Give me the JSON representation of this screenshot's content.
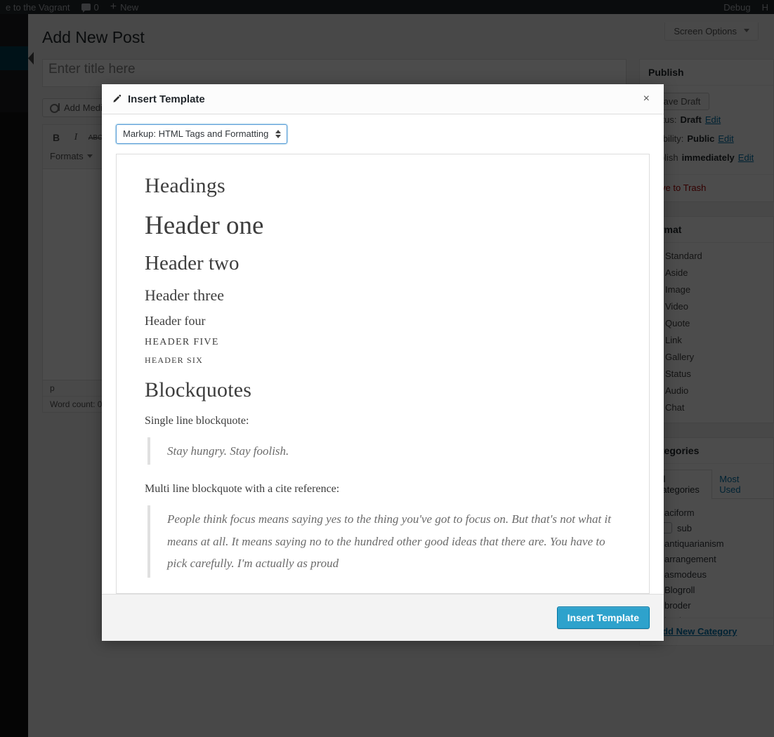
{
  "adminbar": {
    "site_name": "e to the Vagrant",
    "comment_count": "0",
    "new_label": "New",
    "debug_label": "Debug",
    "howdy_label": "H"
  },
  "screen_options": {
    "label": "Screen Options"
  },
  "page": {
    "title": "Add New Post"
  },
  "editor": {
    "title_placeholder": "Enter title here",
    "add_media_label": "Add Media",
    "toolbar": {
      "bold": "B",
      "italic": "I",
      "strikethrough": "ABC",
      "formats_label": "Formats"
    },
    "status": {
      "path": "p",
      "word_count": "Word count: 0"
    }
  },
  "publish": {
    "heading": "Publish",
    "save_draft_label": "Save Draft",
    "status_label": "Status:",
    "status_value": "Draft",
    "status_edit": "Edit",
    "visibility_label": "Visibility:",
    "visibility_value": "Public",
    "visibility_edit": "Edit",
    "schedule_label": "Publish",
    "schedule_value": "immediately",
    "schedule_edit": "Edit",
    "trash_label": "Move to Trash"
  },
  "format": {
    "heading": "Format",
    "items": [
      {
        "label": "Standard",
        "icon": "pin-icon",
        "active": true
      },
      {
        "label": "Aside",
        "icon": "aside-icon",
        "active": false
      },
      {
        "label": "Image",
        "icon": "image-icon",
        "active": false
      },
      {
        "label": "Video",
        "icon": "video-icon",
        "active": false
      },
      {
        "label": "Quote",
        "icon": "quote-icon",
        "active": false
      },
      {
        "label": "Link",
        "icon": "link-icon",
        "active": false
      },
      {
        "label": "Gallery",
        "icon": "gallery-icon",
        "active": false
      },
      {
        "label": "Status",
        "icon": "status-icon",
        "active": false
      },
      {
        "label": "Audio",
        "icon": "audio-icon",
        "active": false
      },
      {
        "label": "Chat",
        "icon": "chat-icon",
        "active": false
      }
    ]
  },
  "categories": {
    "heading": "Categories",
    "tab_all": "All Categories",
    "tab_most_used": "Most Used",
    "items": [
      {
        "label": "aciform",
        "sub": false
      },
      {
        "label": "sub",
        "sub": true
      },
      {
        "label": "antiquarianism",
        "sub": false
      },
      {
        "label": "arrangement",
        "sub": false
      },
      {
        "label": "asmodeus",
        "sub": false
      },
      {
        "label": "Blogroll",
        "sub": false
      },
      {
        "label": "broder",
        "sub": false
      },
      {
        "label": "buying",
        "sub": false
      }
    ],
    "add_new_label": "+ Add New Category"
  },
  "modal": {
    "title": "Insert Template",
    "close_label": "×",
    "select_value": "Markup: HTML Tags and Formatting",
    "insert_button_label": "Insert Template",
    "accent_color": "#2ea2cc",
    "preview": {
      "section_headings": "Headings",
      "h1": "Header one",
      "h2": "Header two",
      "h3": "Header three",
      "h4": "Header four",
      "h5": "Header five",
      "h6": "Header six",
      "section_blockquotes": "Blockquotes",
      "single_label": "Single line blockquote:",
      "single_quote": "Stay hungry. Stay foolish.",
      "multi_label": "Multi line blockquote with a cite reference:",
      "multi_quote": "People think focus means saying yes to the thing you've got to focus on. But that's not what it means at all. It means saying no to the hundred other good ideas that there are. You have to pick carefully. I'm actually as proud"
    }
  }
}
